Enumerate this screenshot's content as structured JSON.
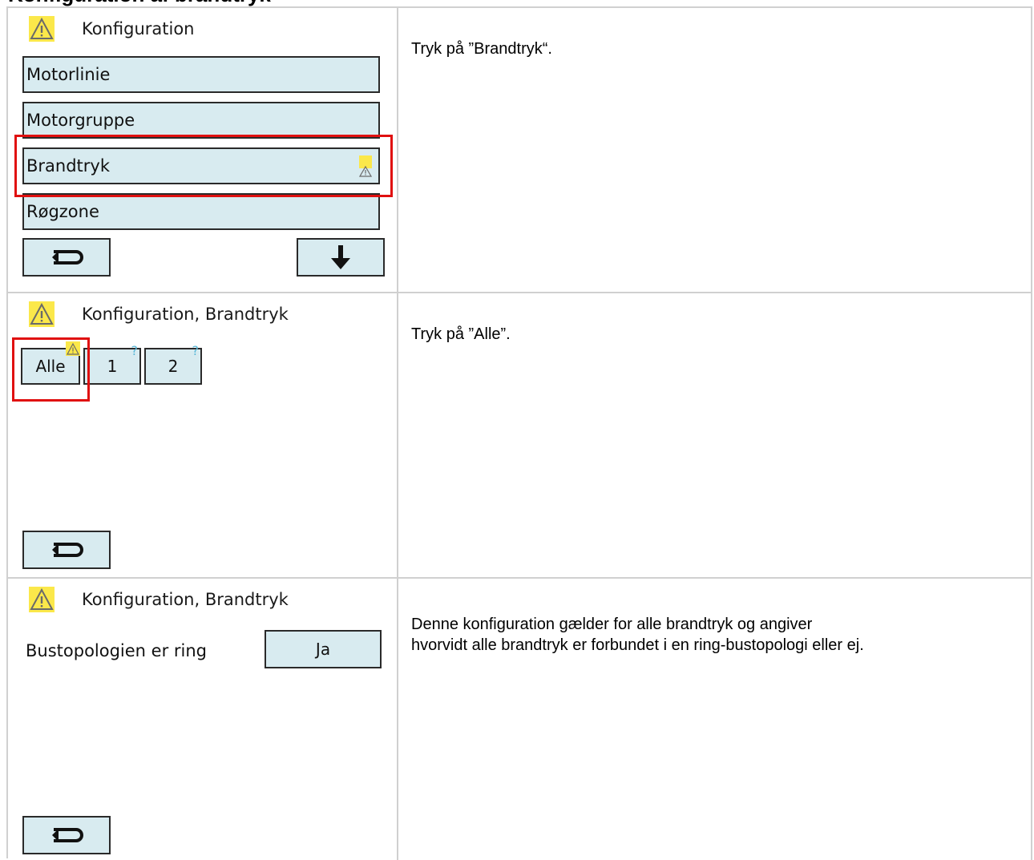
{
  "header": {
    "heading": "Konfiguration af brandtryk"
  },
  "steps": [
    {
      "screen": {
        "title": "Konfiguration",
        "menu_items": [
          {
            "label": "Motorlinie"
          },
          {
            "label": "Motorgruppe"
          },
          {
            "label": "Brandtryk",
            "warning": true,
            "highlighted": true
          },
          {
            "label": "Røgzone"
          }
        ],
        "back_icon": "return-arrow-icon",
        "down_icon": "down-arrow-icon"
      },
      "description": "Tryk på ”Brandtryk“."
    },
    {
      "screen": {
        "title": "Konfiguration, Brandtryk",
        "tabs": [
          {
            "label": "Alle",
            "badge": "warning",
            "highlighted": true
          },
          {
            "label": "1",
            "badge": "?"
          },
          {
            "label": "2",
            "badge": "?"
          }
        ],
        "back_icon": "return-arrow-icon"
      },
      "description": "Tryk på ”Alle”."
    },
    {
      "screen": {
        "title": "Konfiguration, Brandtryk",
        "field_label": "Bustopologien er ring",
        "field_value": "Ja",
        "back_icon": "return-arrow-icon"
      },
      "description_lines": [
        "Denne konfiguration gælder for alle brandtryk og angiver",
        "hvorvidt alle brandtryk er forbundet i en ring-bustopologi eller ej."
      ]
    }
  ],
  "colors": {
    "button_fill": "#d8ebf0",
    "button_border": "#2a2a2a",
    "warning_yellow": "#fbe84a",
    "highlight_red": "#e01010",
    "help_blue": "#5ab8d8"
  }
}
